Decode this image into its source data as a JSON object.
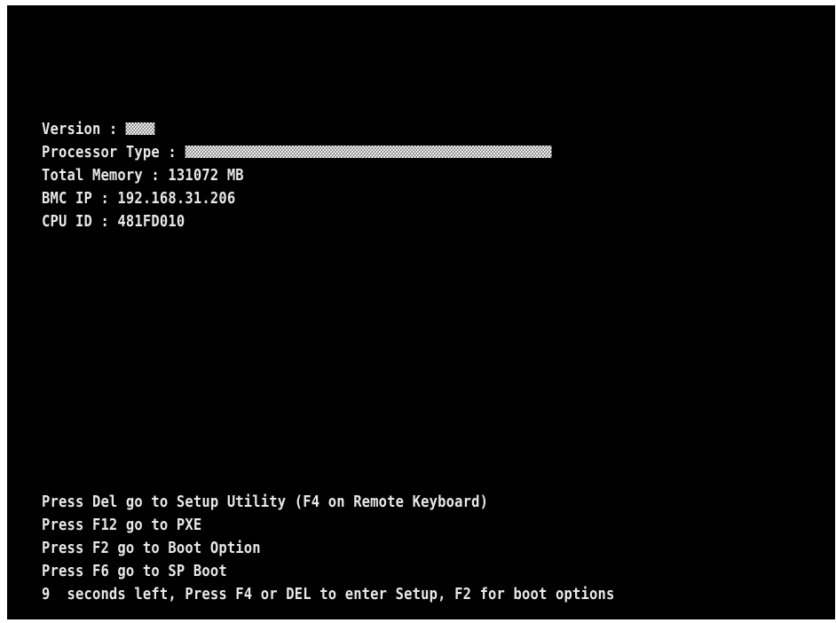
{
  "system_info": {
    "version_label": "Version : ",
    "processor_label": "Processor Type : ",
    "memory_line": "Total Memory : 131072 MB",
    "bmc_ip_line": "BMC IP : 192.168.31.206",
    "cpu_id_line": "CPU ID : 481FD010"
  },
  "prompts": {
    "setup": "Press Del go to Setup Utility (F4 on Remote Keyboard)",
    "pxe": "Press F12 go to PXE",
    "boot_option": "Press F2 go to Boot Option",
    "sp_boot": "Press F6 go to SP Boot",
    "countdown": "9  seconds left, Press F4 or DEL to enter Setup, F2 for boot options"
  },
  "colors": {
    "background": "#000000",
    "text": "#e8e8e8"
  }
}
